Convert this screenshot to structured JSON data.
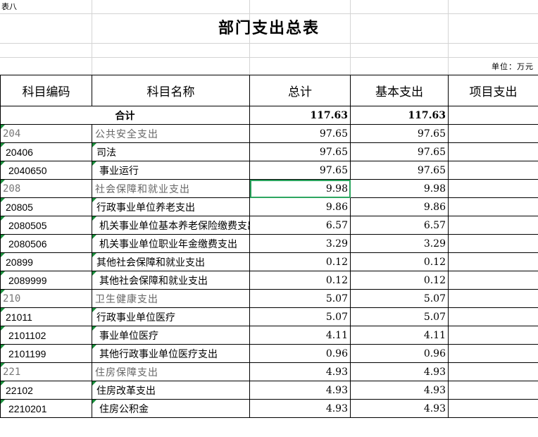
{
  "sheet_label": "表八",
  "title": "部门支出总表",
  "unit": "单位：万元",
  "colors": {
    "selection": "#2da560",
    "marker": "#1a8f3c",
    "gridline": "#d4d4d4"
  },
  "headers": [
    "科目编码",
    "科目名称",
    "总计",
    "基本支出",
    "项目支出"
  ],
  "total_row": {
    "label": "合计",
    "total": "117.63",
    "basic": "117.63",
    "project": ""
  },
  "rows": [
    {
      "code": "204",
      "name": "公共安全支出",
      "total": "97.65",
      "basic": "97.65",
      "project": "",
      "level": 1
    },
    {
      "code": "20406",
      "name": "司法",
      "total": "97.65",
      "basic": "97.65",
      "project": "",
      "level": 2
    },
    {
      "code": "2040650",
      "name": "事业运行",
      "total": "97.65",
      "basic": "97.65",
      "project": "",
      "level": 3
    },
    {
      "code": "208",
      "name": "社会保障和就业支出",
      "total": "9.98",
      "basic": "9.98",
      "project": "",
      "level": 1
    },
    {
      "code": "20805",
      "name": "行政事业单位养老支出",
      "total": "9.86",
      "basic": "9.86",
      "project": "",
      "level": 2
    },
    {
      "code": "2080505",
      "name": "机关事业单位基本养老保险缴费支出",
      "total": "6.57",
      "basic": "6.57",
      "project": "",
      "level": 3
    },
    {
      "code": "2080506",
      "name": "机关事业单位职业年金缴费支出",
      "total": "3.29",
      "basic": "3.29",
      "project": "",
      "level": 3
    },
    {
      "code": "20899",
      "name": "其他社会保障和就业支出",
      "total": "0.12",
      "basic": "0.12",
      "project": "",
      "level": 2
    },
    {
      "code": "2089999",
      "name": "其他社会保障和就业支出",
      "total": "0.12",
      "basic": "0.12",
      "project": "",
      "level": 3
    },
    {
      "code": "210",
      "name": "卫生健康支出",
      "total": "5.07",
      "basic": "5.07",
      "project": "",
      "level": 1
    },
    {
      "code": "21011",
      "name": "行政事业单位医疗",
      "total": "5.07",
      "basic": "5.07",
      "project": "",
      "level": 2
    },
    {
      "code": "2101102",
      "name": "事业单位医疗",
      "total": "4.11",
      "basic": "4.11",
      "project": "",
      "level": 3
    },
    {
      "code": "2101199",
      "name": "其他行政事业单位医疗支出",
      "total": "0.96",
      "basic": "0.96",
      "project": "",
      "level": 3
    },
    {
      "code": "221",
      "name": "住房保障支出",
      "total": "4.93",
      "basic": "4.93",
      "project": "",
      "level": 1
    },
    {
      "code": "22102",
      "name": "住房改革支出",
      "total": "4.93",
      "basic": "4.93",
      "project": "",
      "level": 2
    },
    {
      "code": "2210201",
      "name": "住房公积金",
      "total": "4.93",
      "basic": "4.93",
      "project": "",
      "level": 3
    }
  ]
}
